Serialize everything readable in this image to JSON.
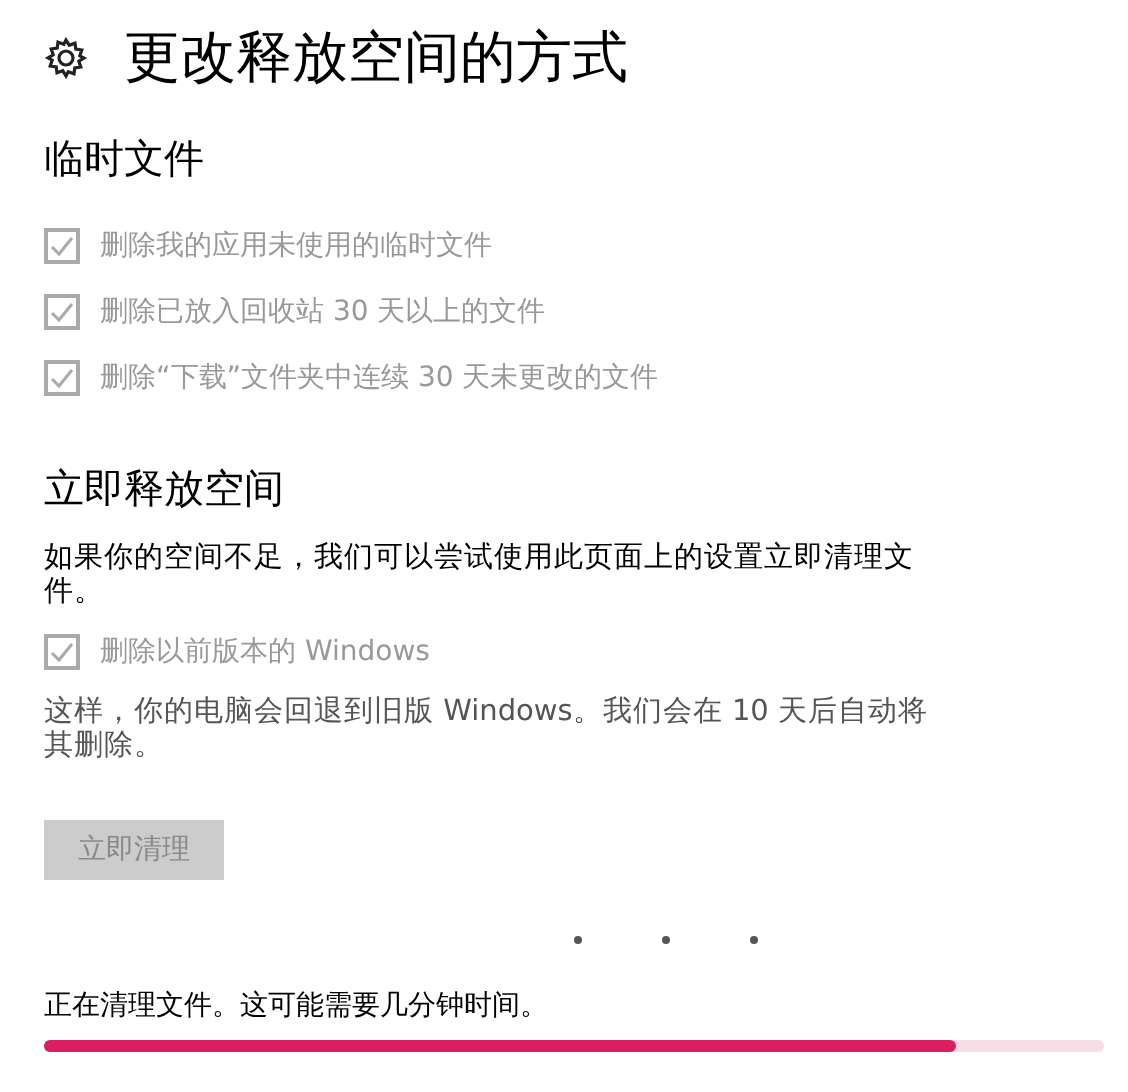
{
  "page": {
    "title": "更改释放空间的方式"
  },
  "sections": [
    {
      "heading": "临时文件",
      "items": [
        {
          "kind": "checkbox",
          "label": "删除我的应用未使用的临时文件",
          "checked": true,
          "disabled": true
        },
        {
          "kind": "checkbox",
          "label": "删除已放入回收站 30 天以上的文件",
          "checked": true,
          "disabled": true
        },
        {
          "kind": "checkbox",
          "label": "删除“下载”文件夹中连续 30 天未更改的文件",
          "checked": true,
          "disabled": true
        }
      ]
    },
    {
      "heading": "立即释放空间",
      "items": [
        {
          "kind": "text",
          "text": "如果你的空间不足，我们可以尝试使用此页面上的设置立即清理文件。",
          "muted": false
        },
        {
          "kind": "checkbox",
          "label": "删除以前版本的 Windows",
          "checked": true,
          "disabled": true
        },
        {
          "kind": "text",
          "text": "这样，你的电脑会回退到旧版 Windows。我们会在 10 天后自动将其删除。",
          "muted": true
        },
        {
          "kind": "button",
          "label": "立即清理",
          "disabled": true
        }
      ]
    }
  ],
  "status": {
    "text": "正在清理文件。这可能需要几分钟时间。",
    "busy": true,
    "level": 0.86
  }
}
